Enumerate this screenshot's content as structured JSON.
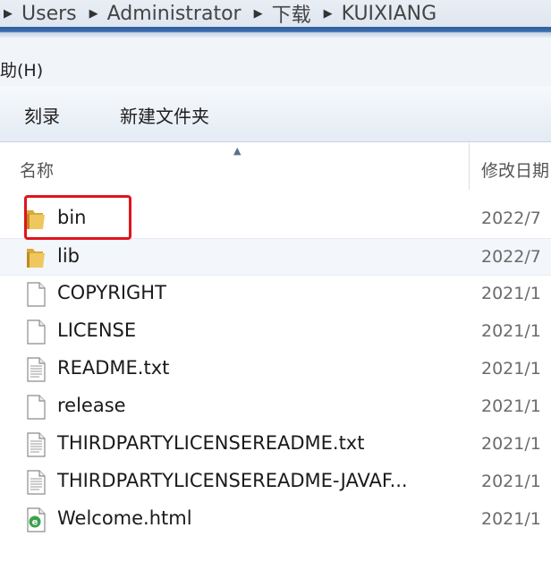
{
  "breadcrumb": [
    "Users",
    "Administrator",
    "下载",
    "KUIXIANG"
  ],
  "menu": {
    "help_label": "助(H)"
  },
  "toolbar": {
    "burn_label": "刻录",
    "new_folder_label": "新建文件夹"
  },
  "columns": {
    "name": "名称",
    "date": "修改日期"
  },
  "files": [
    {
      "name": "bin",
      "date": "2022/7",
      "type": "folder"
    },
    {
      "name": "lib",
      "date": "2022/7",
      "type": "folder"
    },
    {
      "name": "COPYRIGHT",
      "date": "2021/1",
      "type": "file"
    },
    {
      "name": "LICENSE",
      "date": "2021/1",
      "type": "file"
    },
    {
      "name": "README.txt",
      "date": "2021/1",
      "type": "text"
    },
    {
      "name": "release",
      "date": "2021/1",
      "type": "file"
    },
    {
      "name": "THIRDPARTYLICENSEREADME.txt",
      "date": "2021/1",
      "type": "text"
    },
    {
      "name": "THIRDPARTYLICENSEREADME-JAVAF...",
      "date": "2021/1",
      "type": "text"
    },
    {
      "name": "Welcome.html",
      "date": "2021/1",
      "type": "html"
    }
  ],
  "colors": {
    "highlight": "#e0141c",
    "folder": "#e6b94a"
  }
}
